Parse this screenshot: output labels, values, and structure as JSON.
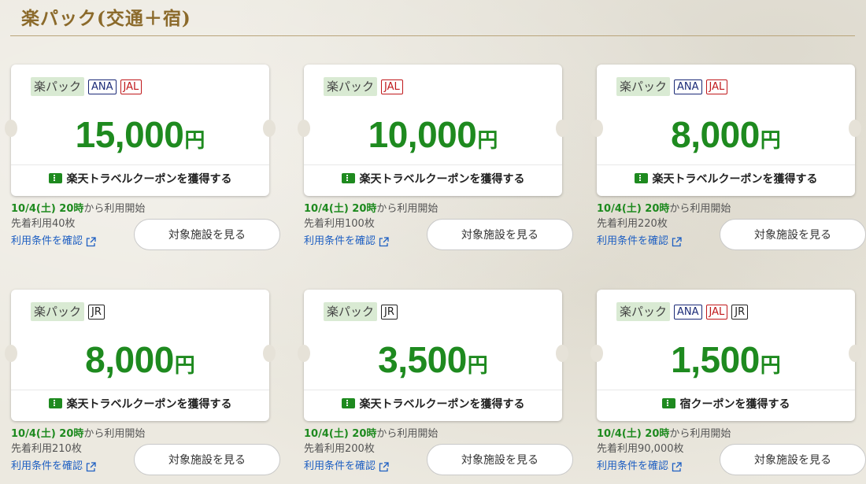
{
  "section": {
    "title": "楽パック(交通＋宿)"
  },
  "cards": [
    {
      "main_tag": "楽パック",
      "carriers": [
        "ANA",
        "JAL"
      ],
      "amount": "15,000",
      "yen": "円",
      "coupon_label": "楽天トラベルクーポンを獲得する",
      "start_date": "10/4(土) 20時",
      "start_suffix": "から利用開始",
      "limit": "先着利用40枚",
      "terms": "利用条件を確認",
      "view_button": "対象施設を見る"
    },
    {
      "main_tag": "楽パック",
      "carriers": [
        "JAL"
      ],
      "amount": "10,000",
      "yen": "円",
      "coupon_label": "楽天トラベルクーポンを獲得する",
      "start_date": "10/4(土) 20時",
      "start_suffix": "から利用開始",
      "limit": "先着利用100枚",
      "terms": "利用条件を確認",
      "view_button": "対象施設を見る"
    },
    {
      "main_tag": "楽パック",
      "carriers": [
        "ANA",
        "JAL"
      ],
      "amount": "8,000",
      "yen": "円",
      "coupon_label": "楽天トラベルクーポンを獲得する",
      "start_date": "10/4(土) 20時",
      "start_suffix": "から利用開始",
      "limit": "先着利用220枚",
      "terms": "利用条件を確認",
      "view_button": "対象施設を見る"
    },
    {
      "main_tag": "楽パック",
      "carriers": [
        "JR"
      ],
      "amount": "8,000",
      "yen": "円",
      "coupon_label": "楽天トラベルクーポンを獲得する",
      "start_date": "10/4(土) 20時",
      "start_suffix": "から利用開始",
      "limit": "先着利用210枚",
      "terms": "利用条件を確認",
      "view_button": "対象施設を見る"
    },
    {
      "main_tag": "楽パック",
      "carriers": [
        "JR"
      ],
      "amount": "3,500",
      "yen": "円",
      "coupon_label": "楽天トラベルクーポンを獲得する",
      "start_date": "10/4(土) 20時",
      "start_suffix": "から利用開始",
      "limit": "先着利用200枚",
      "terms": "利用条件を確認",
      "view_button": "対象施設を見る"
    },
    {
      "main_tag": "楽パック",
      "carriers": [
        "ANA",
        "JAL",
        "JR"
      ],
      "amount": "1,500",
      "yen": "円",
      "coupon_label": "宿クーポンを獲得する",
      "start_date": "10/4(土) 20時",
      "start_suffix": "から利用開始",
      "limit": "先着利用90,000枚",
      "terms": "利用条件を確認",
      "view_button": "対象施設を見る"
    }
  ],
  "colors": {
    "accent_green": "#1e8a1f",
    "title_gold": "#8b6a2b",
    "link_blue": "#1e5fc2",
    "ana_navy": "#1b2a77",
    "jal_red": "#c0181b"
  }
}
